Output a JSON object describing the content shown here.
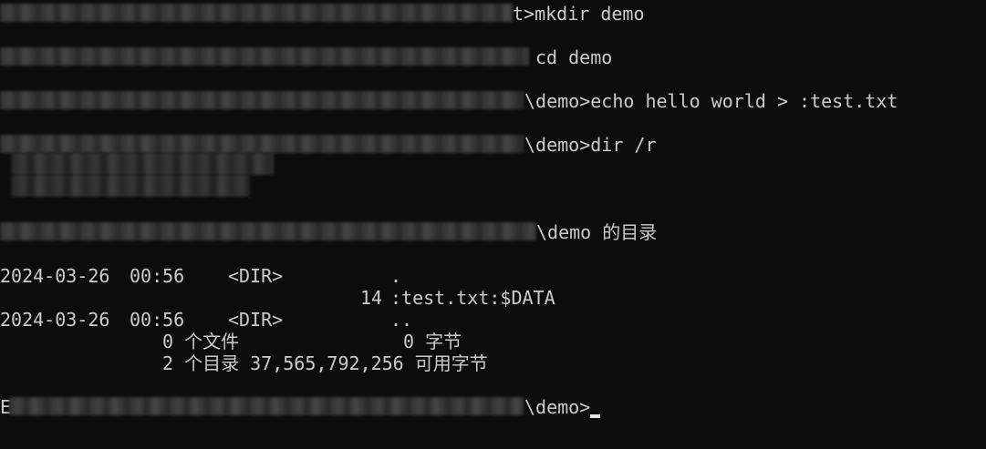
{
  "terminal": {
    "cmd1": {
      "prompt_tail": "t>",
      "command": "mkdir demo"
    },
    "cmd2": {
      "command": "cd demo"
    },
    "cmd3": {
      "prompt_tail": "\\demo>",
      "command": "echo hello world > :test.txt"
    },
    "cmd4": {
      "prompt_tail": "\\demo>",
      "command": "dir /r"
    },
    "dir_header": "\\demo 的目录",
    "entries": [
      {
        "date": "2024-03-26",
        "time": "00:56",
        "type": "<DIR>",
        "name": "."
      },
      {
        "size": "14",
        "name": ":test.txt:$DATA"
      },
      {
        "date": "2024-03-26",
        "time": "00:56",
        "type": "<DIR>",
        "name": ".."
      }
    ],
    "summary_files": {
      "count": "0",
      "label": "个文件",
      "bytes": "0",
      "bytes_label": "字节"
    },
    "summary_dirs": {
      "count": "2",
      "label": "个目录",
      "free": "37,565,792,256",
      "free_label": "可用字节"
    },
    "final_prompt": {
      "drive_letter": "E",
      "prompt_tail": "\\demo>"
    }
  }
}
